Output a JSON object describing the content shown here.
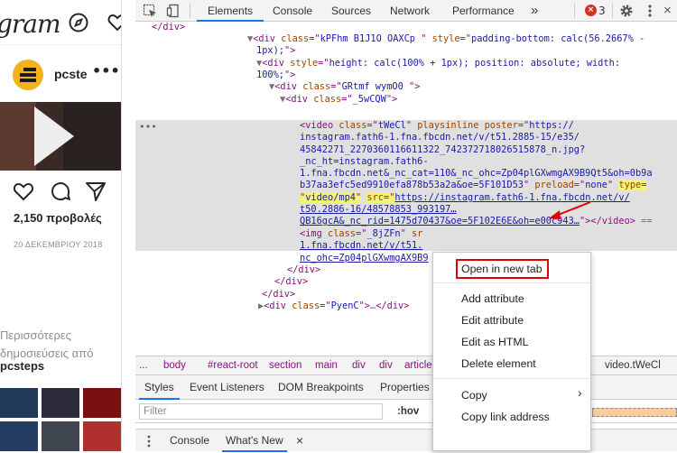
{
  "instagram": {
    "logo": "gram",
    "username": "pcste",
    "more": "•••",
    "views": "2,150 προβολές",
    "date": "20 ΔΕΚΕΜΒΡΙΟΥ 2018",
    "more_posts_line1": "Περισσότερες",
    "more_posts_line2": "δημοσιεύσεις από",
    "more_posts_user": "pcsteps"
  },
  "devtools": {
    "tabs": [
      "Elements",
      "Console",
      "Sources",
      "Network",
      "Performance"
    ],
    "overflow": "»",
    "error_count": "3",
    "error_badge": "×",
    "settings_icon": "gear-icon",
    "menu_icon": "kebab-icon"
  },
  "dom_lines": [
    {
      "segments": [
        {
          "t": "</div>",
          "c": "tag"
        }
      ]
    },
    {
      "segments": [
        {
          "t": "▼",
          "c": "tri"
        },
        {
          "t": "<div ",
          "c": "tag"
        },
        {
          "t": "class",
          "c": "an"
        },
        {
          "t": "=\"",
          "c": "tag"
        },
        {
          "t": "kPFhm B1J1O OAXCp ",
          "c": "av"
        },
        {
          "t": "\" ",
          "c": "tag"
        },
        {
          "t": "style",
          "c": "an"
        },
        {
          "t": "=\"",
          "c": "tag"
        },
        {
          "t": "padding-bottom: calc(56.2667% -",
          "c": "av"
        }
      ]
    },
    {
      "segments": [
        {
          "t": "1px);",
          "c": "av"
        },
        {
          "t": "\">",
          "c": "tag"
        }
      ]
    },
    {
      "segments": [
        {
          "t": "▼",
          "c": "tri"
        },
        {
          "t": "<div ",
          "c": "tag"
        },
        {
          "t": "style",
          "c": "an"
        },
        {
          "t": "=\"",
          "c": "tag"
        },
        {
          "t": "height: calc(100% + 1px); position: absolute; width:",
          "c": "av"
        }
      ]
    },
    {
      "segments": [
        {
          "t": "100%;",
          "c": "av"
        },
        {
          "t": "\">",
          "c": "tag"
        }
      ]
    },
    {
      "segments": [
        {
          "t": "▼",
          "c": "tri"
        },
        {
          "t": "<div ",
          "c": "tag"
        },
        {
          "t": "class",
          "c": "an"
        },
        {
          "t": "=\"",
          "c": "tag"
        },
        {
          "t": "GRtmf wymO0 ",
          "c": "av"
        },
        {
          "t": "\">",
          "c": "tag"
        }
      ]
    },
    {
      "segments": [
        {
          "t": "▼",
          "c": "tri"
        },
        {
          "t": "<div ",
          "c": "tag"
        },
        {
          "t": "class",
          "c": "an"
        },
        {
          "t": "=\"",
          "c": "tag"
        },
        {
          "t": "_5wCQW",
          "c": "av"
        },
        {
          "t": "\">",
          "c": "tag"
        }
      ]
    },
    {
      "segments": [
        {
          "t": "<video ",
          "c": "tag"
        },
        {
          "t": "class",
          "c": "an"
        },
        {
          "t": "=\"",
          "c": "tag"
        },
        {
          "t": "tWeCl",
          "c": "av"
        },
        {
          "t": "\" ",
          "c": "tag"
        },
        {
          "t": "playsinline poster",
          "c": "an"
        },
        {
          "t": "=\"",
          "c": "tag"
        },
        {
          "t": "https://",
          "c": "av"
        }
      ]
    },
    {
      "segments": [
        {
          "t": "instagram.fath6-1.fna.fbcdn.net/v/t51.2885-15/e35/",
          "c": "av"
        }
      ]
    },
    {
      "segments": [
        {
          "t": "45842271_2270360116611322_742372718026515878_n.jpg?",
          "c": "av"
        }
      ]
    },
    {
      "segments": [
        {
          "t": "_nc_ht=instagram.fath6-",
          "c": "av"
        }
      ]
    },
    {
      "segments": [
        {
          "t": "1.fna.fbcdn.net&_nc_cat=110&_nc_ohc=Zp04plGXwmgAX9B9Qt5&oh=0b9a",
          "c": "av"
        }
      ]
    },
    {
      "segments": [
        {
          "t": "b37aa3efc5ed9910efa878b53a2a&oe=5F101D53",
          "c": "av"
        },
        {
          "t": "\" ",
          "c": "tag"
        },
        {
          "t": "preload",
          "c": "an"
        },
        {
          "t": "=\"",
          "c": "tag"
        },
        {
          "t": "none",
          "c": "av"
        },
        {
          "t": "\" ",
          "c": "tag"
        },
        {
          "t": "type",
          "c": "an yhl"
        },
        {
          "t": "=",
          "c": "tag yhl"
        }
      ]
    },
    {
      "segments": [
        {
          "t": "\"",
          "c": "tag yhl"
        },
        {
          "t": "video/mp4",
          "c": "av yhl"
        },
        {
          "t": "\"",
          "c": "tag yhl"
        },
        {
          "t": " ",
          "c": "tag"
        },
        {
          "t": "src",
          "c": "an yhl"
        },
        {
          "t": "=\"",
          "c": "tag yhl"
        },
        {
          "t": "https://instagram.fath6-1.fna.fbcdn.net/v/",
          "c": "link"
        }
      ]
    },
    {
      "segments": [
        {
          "t": "t50.2886-16/48578853_993197…",
          "c": "link"
        }
      ]
    },
    {
      "segments": [
        {
          "t": "QB16gcA&_nc_rid=1475d70437&oe=5F102E6E&oh=e00c943…",
          "c": "link"
        },
        {
          "t": "\">",
          "c": "tag"
        },
        {
          "t": "</video>",
          "c": "tag"
        },
        {
          "t": " ==",
          "c": "tri"
        }
      ]
    },
    {
      "segments": [
        {
          "t": "<img ",
          "c": "tag"
        },
        {
          "t": "class",
          "c": "an"
        },
        {
          "t": "=\"",
          "c": "tag"
        },
        {
          "t": "_8jZFn",
          "c": "av"
        },
        {
          "t": "\" ",
          "c": "tag"
        },
        {
          "t": "sr",
          "c": "an"
        }
      ]
    },
    {
      "segments": [
        {
          "t": "1.fna.fbcdn.net/v/t51.",
          "c": "link"
        }
      ]
    },
    {
      "segments": [
        {
          "t": "nc_ohc=Zp04plGXwmgAX9B9",
          "c": "link"
        },
        {
          "t": "                       ",
          "c": "tag"
        },
        {
          "t": "3",
          "c": "link"
        },
        {
          "t": "\">",
          "c": "tag"
        }
      ]
    },
    {
      "segments": [
        {
          "t": "</div>",
          "c": "tag"
        }
      ]
    },
    {
      "segments": [
        {
          "t": "</div>",
          "c": "tag"
        }
      ]
    },
    {
      "segments": [
        {
          "t": "</div>",
          "c": "tag"
        }
      ]
    },
    {
      "segments": [
        {
          "t": "▶",
          "c": "tri"
        },
        {
          "t": "<div ",
          "c": "tag"
        },
        {
          "t": "class",
          "c": "an"
        },
        {
          "t": "=\"",
          "c": "tag"
        },
        {
          "t": "PyenC",
          "c": "av"
        },
        {
          "t": "\">",
          "c": "tag"
        },
        {
          "t": "…",
          "c": "tri"
        },
        {
          "t": "</div>",
          "c": "tag"
        }
      ]
    }
  ],
  "line_indents": [
    18,
    124,
    134,
    134,
    134,
    148,
    160,
    182,
    182,
    182,
    182,
    182,
    182,
    182,
    182,
    182,
    182,
    182,
    182,
    168,
    154,
    140,
    136
  ],
  "ellipsis": "•••",
  "breadcrumbs": [
    "...",
    "body",
    "#react-root",
    "section",
    "main",
    "div",
    "div",
    "article",
    "video.tWeCl"
  ],
  "subtabs": [
    "Styles",
    "Event Listeners",
    "DOM Breakpoints",
    "Properties"
  ],
  "filter": {
    "placeholder": "Filter",
    "hov": ":hov"
  },
  "drawer_tabs": [
    "Console",
    "What's New"
  ],
  "drawer_close": "×",
  "context_menu": {
    "items": [
      "Open in new tab",
      "Add attribute",
      "Edit attribute",
      "Edit as HTML",
      "Delete element",
      "Copy",
      "Copy link address"
    ],
    "submenu_arrow": "›"
  },
  "colors": {
    "highlight": "#e00000",
    "accent": "#1a73e8"
  }
}
